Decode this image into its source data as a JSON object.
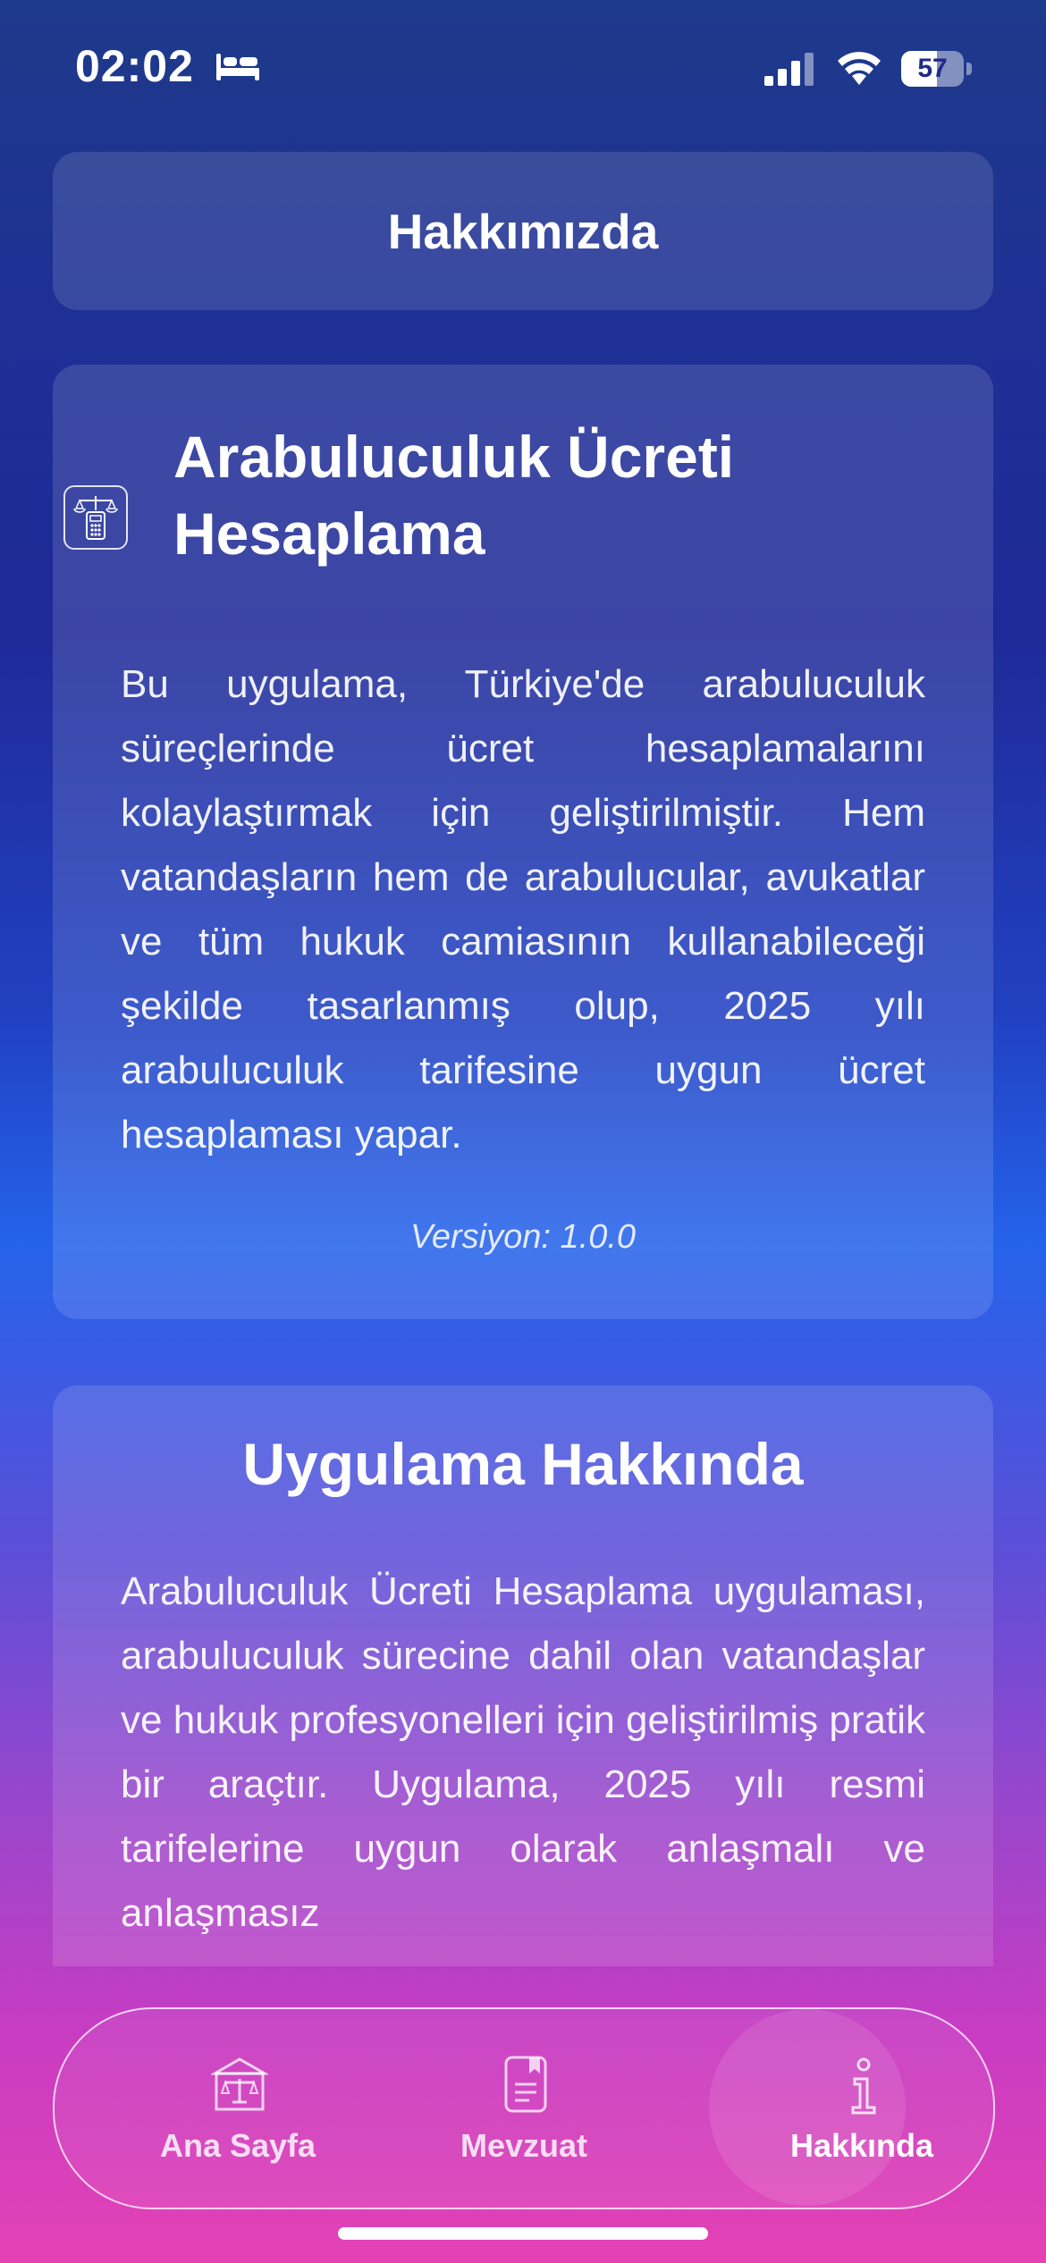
{
  "status_bar": {
    "time": "02:02",
    "battery_level": "57",
    "icons": [
      "bed-icon",
      "cellular-signal-icon",
      "wifi-icon",
      "battery-icon"
    ]
  },
  "header": {
    "title": "Hakkımızda"
  },
  "app_card": {
    "icon": "scale-calculator-icon",
    "title": "Arabuluculuk Ücreti Hesaplama",
    "description": "Bu uygulama, Türkiye'de arabuluculuk süreçlerinde ücret hesaplamalarını kolaylaştırmak için geliştirilmiştir. Hem vatandaşların hem de arabulucular, avukatlar ve tüm hukuk camiasının kullanabileceği şekilde tasarlanmış olup, 2025 yılı arabuluculuk tarifesine uygun ücret hesaplaması yapar.",
    "version": "Versiyon: 1.0.0"
  },
  "about_card": {
    "title": "Uygulama Hakkında",
    "description": "Arabuluculuk Ücreti Hesaplama uygulaması, arabuluculuk sürecine dahil olan vatandaşlar ve hukuk profesyonelleri için geliştirilmiş pratik bir araçtır. Uygulama, 2025 yılı resmi tarifelerine uygun olarak anlaşmalı ve anlaşmasız"
  },
  "tab_bar": {
    "active": "Hakkında",
    "tabs": [
      {
        "label": "Ana Sayfa",
        "icon": "courthouse-scale-icon"
      },
      {
        "label": "Mevzuat",
        "icon": "document-icon"
      },
      {
        "label": "Hakkında",
        "icon": "info-icon"
      }
    ]
  },
  "colors": {
    "gradient_top": "#1e3a8a",
    "gradient_mid": "#2563eb",
    "gradient_bottom": "#e442b4"
  }
}
